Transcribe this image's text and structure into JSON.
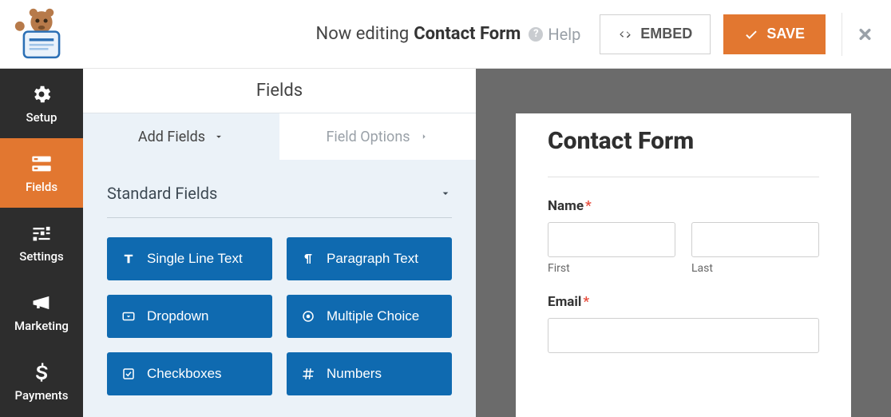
{
  "top": {
    "editing_prefix": "Now editing",
    "form_name": "Contact Form",
    "help": "Help",
    "embed": "EMBED",
    "save": "SAVE"
  },
  "nav": {
    "setup": "Setup",
    "fields": "Fields",
    "settings": "Settings",
    "marketing": "Marketing",
    "payments": "Payments"
  },
  "pane": {
    "title": "Fields",
    "tab_add": "Add Fields",
    "tab_options": "Field Options",
    "section_standard": "Standard Fields"
  },
  "field_buttons": {
    "single_line": "Single Line Text",
    "paragraph": "Paragraph Text",
    "dropdown": "Dropdown",
    "multiple_choice": "Multiple Choice",
    "checkboxes": "Checkboxes",
    "numbers": "Numbers"
  },
  "preview": {
    "title": "Contact Form",
    "name_label": "Name",
    "first": "First",
    "last": "Last",
    "email_label": "Email"
  }
}
